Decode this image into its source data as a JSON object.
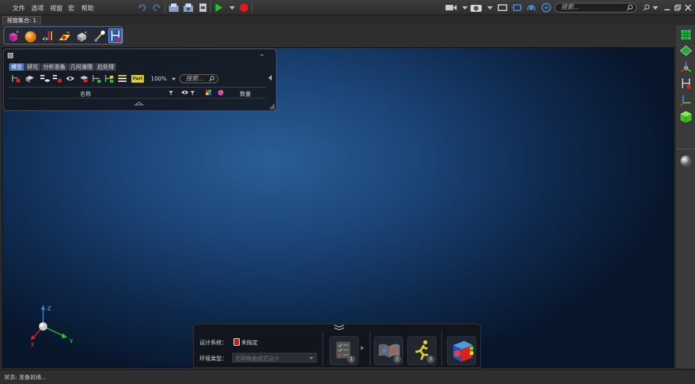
{
  "menu": {
    "items": [
      "文件",
      "选项",
      "视窗",
      "宏",
      "帮助"
    ]
  },
  "search": {
    "placeholder": "搜索..."
  },
  "tab": {
    "label": "视窗集合: 1"
  },
  "model_panel": {
    "tabs": [
      "模型",
      "研究",
      "分析准备",
      "几何清理",
      "后处理"
    ],
    "active_tab": "模型",
    "zoom": "100%",
    "search_placeholder": "搜索...",
    "part_label": "Part 1",
    "columns": {
      "name": "名称",
      "count": "数量"
    }
  },
  "triad": {
    "x": "X",
    "y": "Y",
    "z": "Z"
  },
  "bottom_panel": {
    "design_system_label": "设计系统：",
    "design_system_value": "未指定",
    "env_type_label": "环境类型：",
    "env_type_value": "无网格曲成式设计",
    "steps": [
      "1",
      "2",
      "3"
    ]
  },
  "status": {
    "text": "状态: 准备就绪..."
  },
  "colors": {
    "accent": "#3d6fb8",
    "run": "#22c322",
    "record": "#e41818"
  }
}
